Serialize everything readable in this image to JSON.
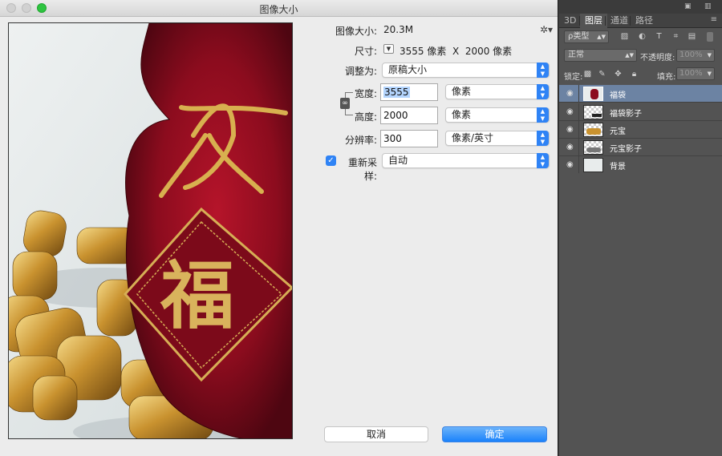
{
  "dialog": {
    "title": "图像大小",
    "image_size_label": "图像大小:",
    "image_size_value": "20.3M",
    "dimensions_label": "尺寸:",
    "dimensions_value": "3555 像素  X  2000 像素",
    "fit_to_label": "调整为:",
    "fit_to_value": "原稿大小",
    "width_label": "宽度:",
    "width_value": "3555",
    "width_unit": "像素",
    "height_label": "高度:",
    "height_value": "2000",
    "height_unit": "像素",
    "resolution_label": "分辨率:",
    "resolution_value": "300",
    "resolution_unit": "像素/英寸",
    "resample_label": "重新采样:",
    "resample_value": "自动",
    "cancel_label": "取消",
    "ok_label": "确定",
    "preview_glyph": "福",
    "accent_color": "#2f83f5"
  },
  "layers_panel": {
    "tabs": [
      {
        "label": "3D"
      },
      {
        "label": "图层"
      },
      {
        "label": "通道"
      },
      {
        "label": "路径"
      }
    ],
    "filter_kind": "ρ类型",
    "blend_mode": "正常",
    "opacity_label": "不透明度:",
    "opacity_value": "100%",
    "lock_label": "锁定:",
    "fill_label": "填充:",
    "fill_value": "100%",
    "layers": [
      {
        "name": "福袋",
        "selected": true
      },
      {
        "name": "福袋影子",
        "selected": false
      },
      {
        "name": "元宝",
        "selected": false
      },
      {
        "name": "元宝影子",
        "selected": false
      },
      {
        "name": "背景",
        "selected": false
      }
    ]
  }
}
